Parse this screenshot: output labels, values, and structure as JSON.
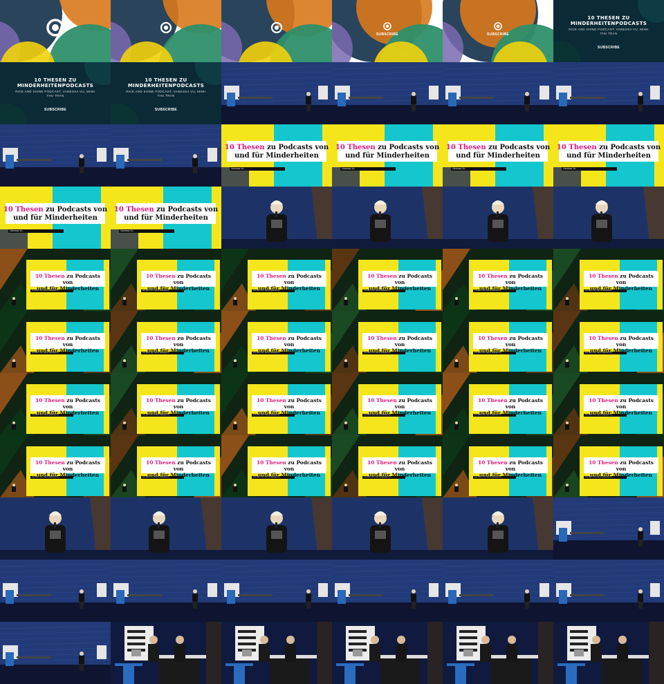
{
  "video": {
    "title_lines": [
      "10 THESEN ZU",
      "MINDERHEITENPODCASTS"
    ],
    "speakers": "RICE AND SHINE PODCAST, VANESSA VU, MINH THU TRAN",
    "subscribe": "SUBSCRIBE"
  },
  "slide": {
    "highlight": "10 Thesen",
    "rest_line1": " zu Podcasts von",
    "line2": "und für Minderheiten",
    "name_short": "Vanessa Vu",
    "name_long": "von Minh Thu Tran & Vanessa Vu"
  },
  "colors": {
    "intro_blue": "#1f3a52",
    "intro_green": "#2e8f6a",
    "intro_orange": "#d8791c",
    "intro_purple": "#7a6ab0",
    "intro_yellow": "#f2d20c",
    "slide_yellow": "#f5e61c",
    "slide_cyan": "#14c7cf",
    "accent_pink": "#e0197d",
    "stage_blue": "#223a78"
  },
  "frames": [
    "intro-logo",
    "intro-logo",
    "intro-logo",
    "intro-subscribe",
    "intro-subscribe",
    "intro-title",
    "intro-title",
    "intro-title",
    "stage-wide",
    "stage-wide",
    "stage-wide",
    "stage-wide",
    "stage-wide",
    "stage-wide",
    "slide-full",
    "slide-full",
    "slide-full",
    "slide-full",
    "slide-full",
    "slide-full",
    "speaker-close",
    "speaker-close",
    "speaker-close",
    "speaker-close",
    "slide-inset",
    "slide-inset",
    "slide-inset",
    "slide-inset",
    "slide-inset",
    "slide-inset",
    "slide-inset",
    "slide-inset",
    "slide-inset",
    "slide-inset",
    "slide-inset",
    "slide-inset",
    "slide-inset",
    "slide-inset",
    "slide-inset",
    "slide-inset",
    "slide-inset",
    "slide-inset",
    "slide-inset",
    "slide-inset",
    "slide-inset",
    "slide-inset",
    "slide-inset",
    "slide-inset",
    "speaker-close",
    "speaker-close",
    "speaker-close",
    "speaker-close",
    "speaker-close",
    "stage-wide",
    "stage-wide",
    "stage-wide",
    "stage-wide",
    "stage-wide",
    "stage-wide",
    "stage-wide",
    "stage-wide",
    "duo-podium",
    "duo-podium",
    "duo-podium",
    "duo-podium",
    "duo-podium"
  ]
}
